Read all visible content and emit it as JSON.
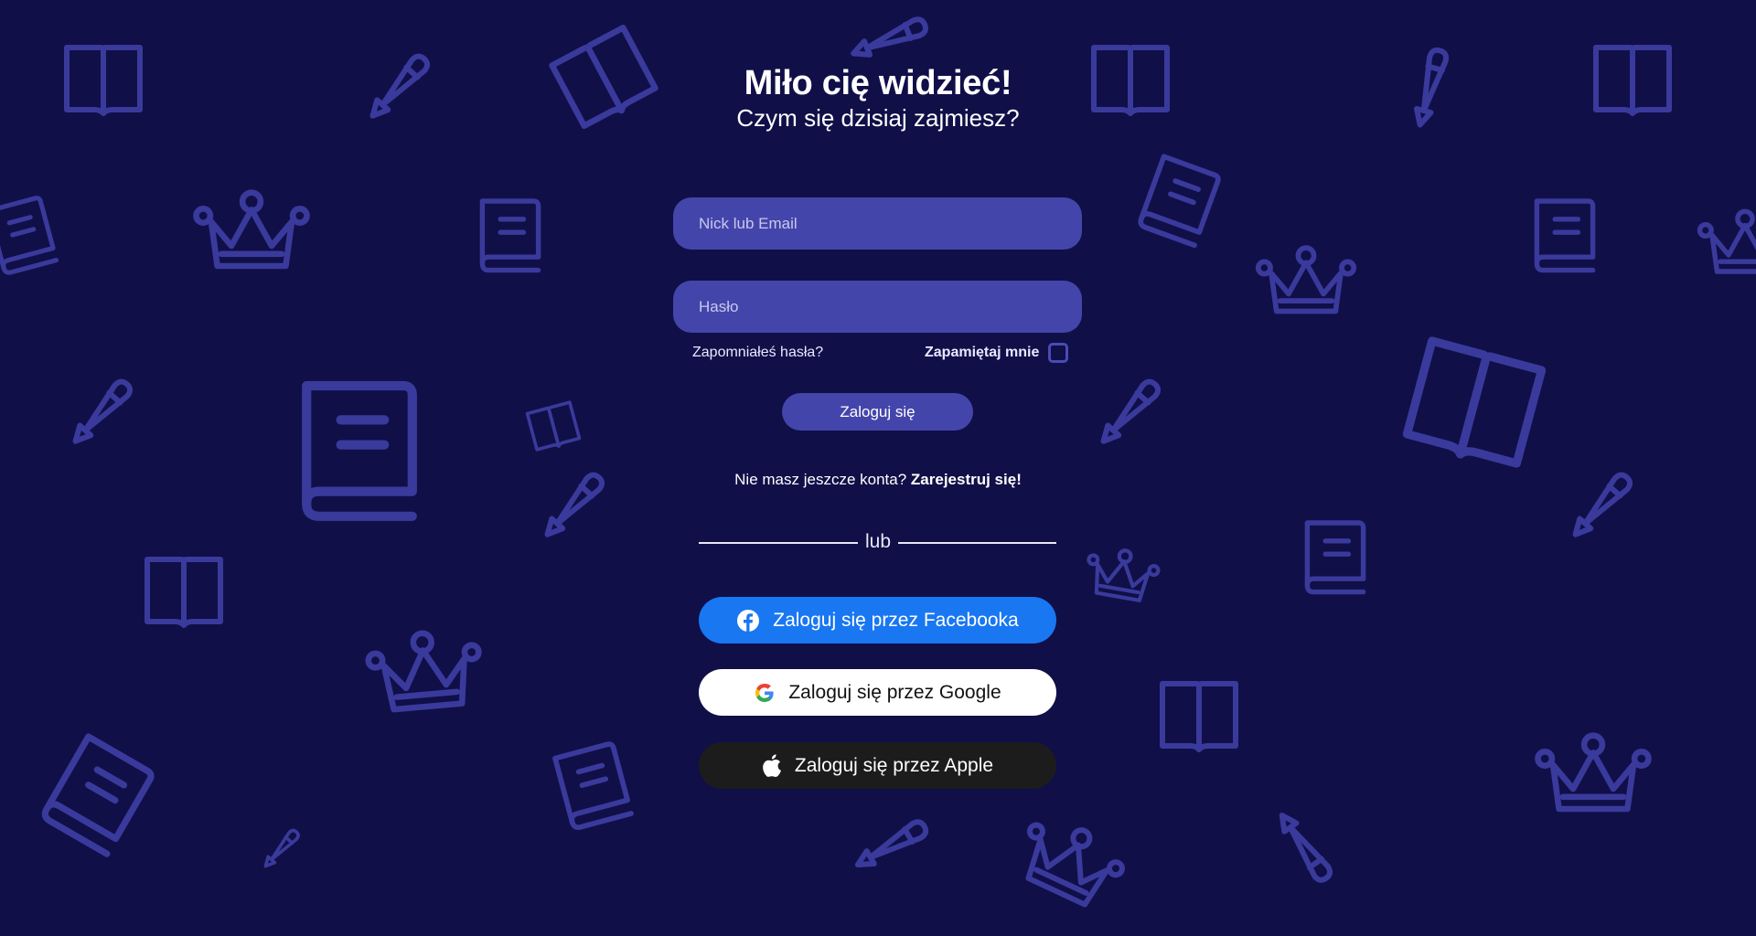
{
  "header": {
    "title": "Miło cię widzieć!",
    "subtitle": "Czym się dzisiaj zajmiesz?"
  },
  "form": {
    "login_placeholder": "Nick lub Email",
    "password_placeholder": "Hasło",
    "forgot_password": "Zapomniałeś hasła?",
    "remember_me": "Zapamiętaj mnie",
    "remember_checked": false,
    "submit_label": "Zaloguj się"
  },
  "register": {
    "prompt": "Nie masz jeszcze konta?",
    "link": "Zarejestruj się!"
  },
  "divider": {
    "label": "lub"
  },
  "social": {
    "facebook": {
      "label": "Zaloguj się przez Facebooka",
      "icon": "facebook-icon",
      "color": "#1977f2"
    },
    "google": {
      "label": "Zaloguj się przez Google",
      "icon": "google-icon",
      "color": "#ffffff"
    },
    "apple": {
      "label": "Zaloguj się przez Apple",
      "icon": "apple-icon",
      "color": "#1c1c1c"
    }
  },
  "theme": {
    "background": "#100f48",
    "accent": "#4445ab",
    "pattern_color": "#3a3a9c",
    "pattern_icons": [
      "open-book-icon",
      "pencil-icon",
      "crown-icon",
      "closed-book-icon"
    ]
  }
}
